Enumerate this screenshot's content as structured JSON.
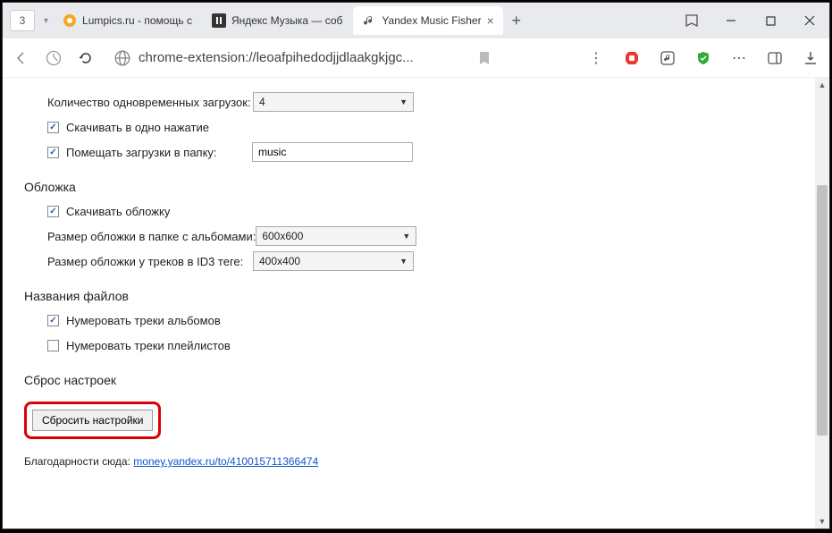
{
  "titlebar": {
    "tab_count": "3",
    "tabs": [
      {
        "title": "Lumpics.ru - помощь с",
        "active": false
      },
      {
        "title": "Яндекс Музыка — соб",
        "active": false
      },
      {
        "title": "Yandex Music Fisher",
        "active": true
      }
    ]
  },
  "addrbar": {
    "url": "chrome-extension://leoafpihedodjjdlaakgkjgc..."
  },
  "settings": {
    "downloads": {
      "concurrent_label": "Количество одновременных загрузок:",
      "concurrent_value": "4",
      "oneclick_label": "Скачивать в одно нажатие",
      "folder_label": "Помещать загрузки в папку:",
      "folder_value": "music"
    },
    "cover": {
      "heading": "Обложка",
      "download_label": "Скачивать обложку",
      "album_size_label": "Размер обложки в папке с альбомами:",
      "album_size_value": "600x600",
      "id3_size_label": "Размер обложки у треков в ID3 теге:",
      "id3_size_value": "400x400"
    },
    "filenames": {
      "heading": "Названия файлов",
      "number_albums_label": "Нумеровать треки альбомов",
      "number_playlists_label": "Нумеровать треки плейлистов"
    },
    "reset": {
      "heading": "Сброс настроек",
      "button": "Сбросить настройки"
    },
    "thanks_prefix": "Благодарности сюда: ",
    "thanks_link": "money.yandex.ru/to/410015711366474"
  }
}
